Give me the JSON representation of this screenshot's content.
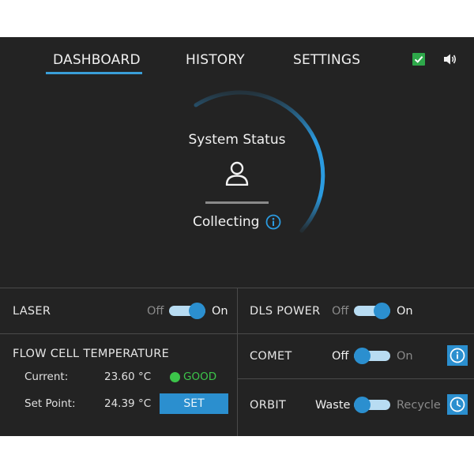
{
  "nav": {
    "tabs": [
      {
        "label": "DASHBOARD",
        "active": true
      },
      {
        "label": "HISTORY",
        "active": false
      },
      {
        "label": "SETTINGS",
        "active": false
      }
    ],
    "icons": [
      "checkbox-checked-icon",
      "speaker-icon"
    ]
  },
  "status": {
    "title": "System Status",
    "state": "Collecting",
    "icon": "user-icon",
    "info_icon": "info-icon"
  },
  "laser": {
    "label": "LASER",
    "off": "Off",
    "on": "On",
    "state": "on"
  },
  "dls_power": {
    "label": "DLS POWER",
    "off": "Off",
    "on": "On",
    "state": "on"
  },
  "flow_cell": {
    "title": "FLOW CELL TEMPERATURE",
    "current_label": "Current:",
    "current_value": "23.60 °C",
    "status": "GOOD",
    "setpoint_label": "Set Point:",
    "setpoint_value": "24.39 °C",
    "set_button": "SET"
  },
  "comet": {
    "label": "COMET",
    "off": "Off",
    "on": "On",
    "state": "off",
    "icon": "info-icon"
  },
  "orbit": {
    "label": "ORBIT",
    "off": "Waste",
    "on": "Recycle",
    "state": "off",
    "icon": "clock-icon"
  },
  "colors": {
    "accent": "#2b8fcf",
    "good": "#3cc44a",
    "panel": "#232323",
    "checkbox": "#2ea84a"
  }
}
